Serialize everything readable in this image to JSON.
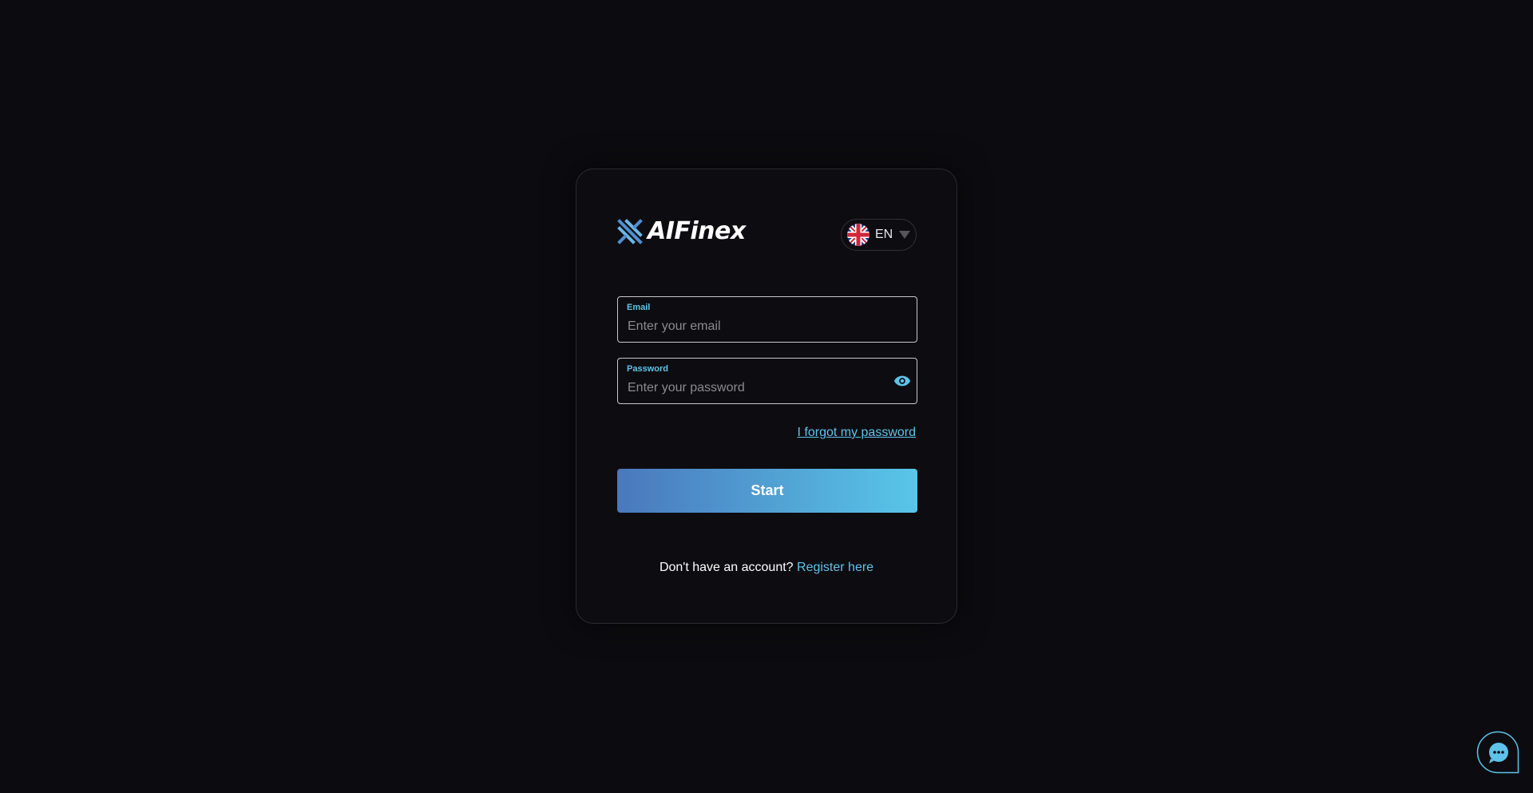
{
  "brand": {
    "name": "AIFinex",
    "accent_color": "#5ec2ea",
    "logo_icon": "aifinex-logo-icon"
  },
  "language": {
    "code": "EN",
    "flag_icon": "uk-flag-icon"
  },
  "email": {
    "label": "Email",
    "placeholder": "Enter your email",
    "value": ""
  },
  "password": {
    "label": "Password",
    "placeholder": "Enter your password",
    "value": "",
    "toggle_icon": "eye-icon"
  },
  "forgot_password": "I forgot my password",
  "start_button": "Start",
  "register": {
    "prompt": "Don't have an account?",
    "link": "Register here"
  },
  "chat": {
    "icon": "chat-bubble-icon"
  }
}
